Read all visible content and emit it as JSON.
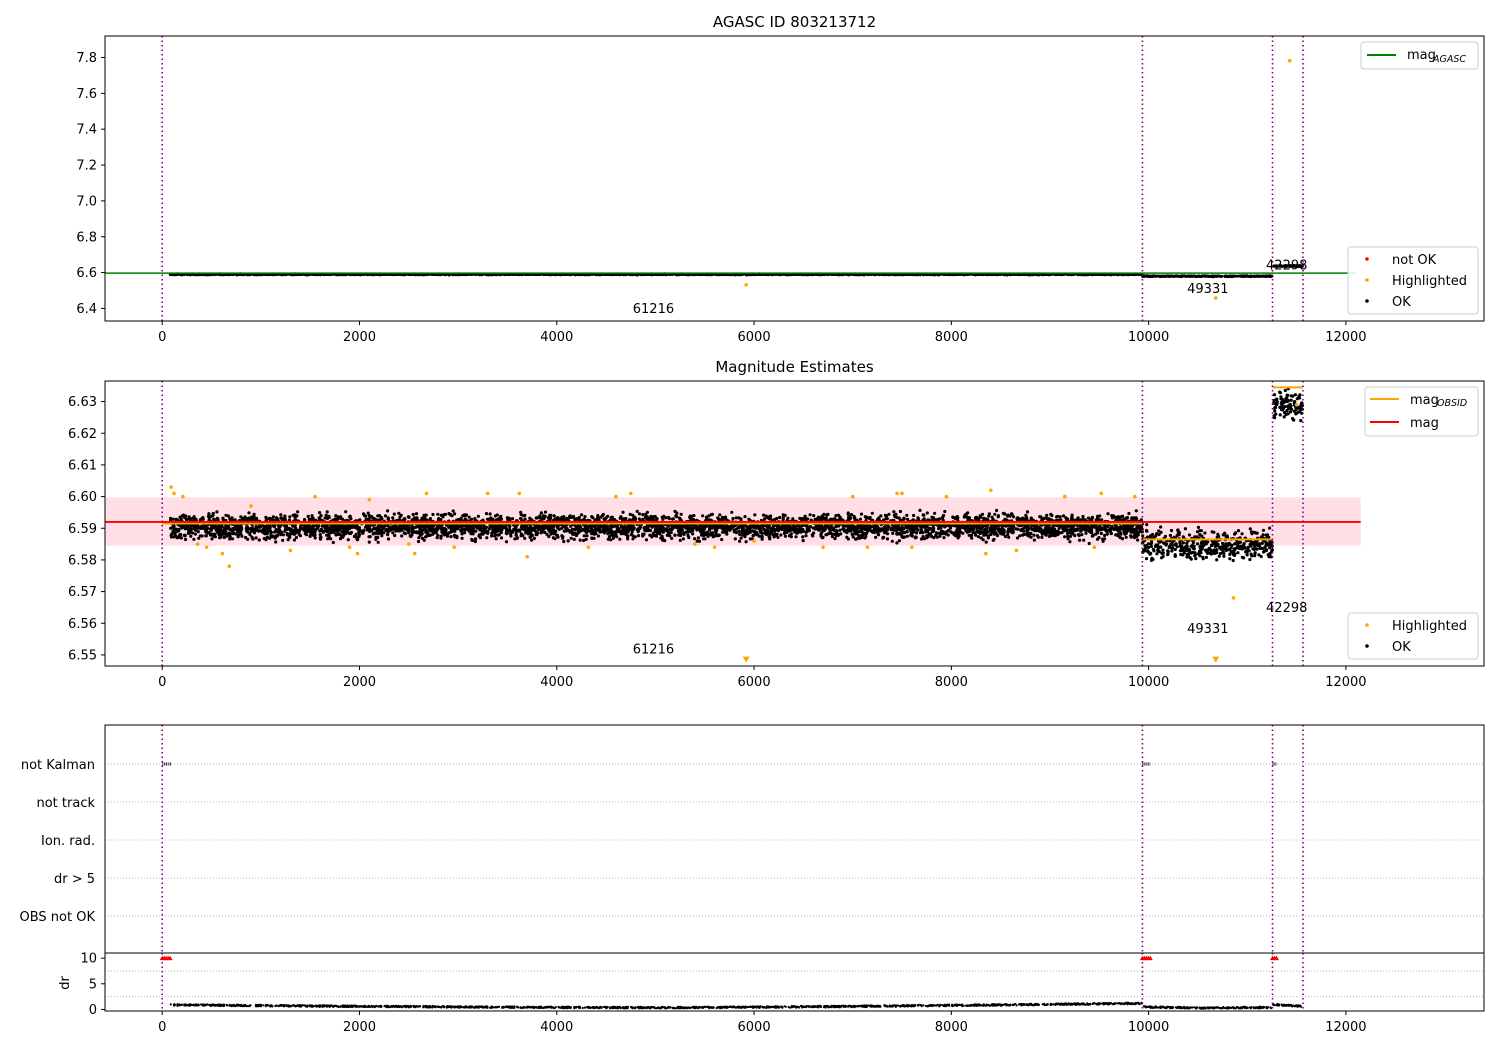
{
  "chart_data": [
    {
      "type": "scatter",
      "title": "AGASC ID 803213712",
      "xlim": [
        -580,
        13400
      ],
      "ylim": [
        6.33,
        7.92
      ],
      "x_ticks": [
        0,
        2000,
        4000,
        6000,
        8000,
        10000,
        12000
      ],
      "y_ticks": [
        6.4,
        6.6,
        6.8,
        7.0,
        7.2,
        7.4,
        7.6,
        7.8
      ],
      "vlines": [
        0,
        9937,
        11256,
        11565
      ],
      "hline": {
        "name": "mag_AGASC",
        "y": 6.597
      },
      "segments": [
        {
          "x": [
            80,
            9937
          ],
          "center": 6.59,
          "spread": 0.005
        },
        {
          "x": [
            9937,
            11256
          ],
          "center": 6.58,
          "spread": 0.005
        },
        {
          "x": [
            11256,
            11565
          ],
          "center": 6.637,
          "spread": 0.006
        }
      ],
      "highlighted": [
        [
          5920,
          6.532
        ],
        [
          10680,
          6.458
        ],
        [
          11430,
          7.782
        ]
      ],
      "annotations": [
        {
          "text": "61216",
          "x": 4980,
          "y": 6.375
        },
        {
          "text": "49331",
          "x": 10600,
          "y": 6.487
        },
        {
          "text": "42298",
          "x": 11400,
          "y": 6.618
        }
      ],
      "legend_line": {
        "base": "mag",
        "sub": "AGASC",
        "color": "#008000"
      },
      "legend_points": [
        {
          "label": "not OK",
          "color": "#ff0000"
        },
        {
          "label": "Highlighted",
          "color": "#ffa500"
        },
        {
          "label": "OK",
          "color": "#000000"
        }
      ]
    },
    {
      "type": "scatter",
      "title": "Magnitude Estimates",
      "xlim": [
        -580,
        13400
      ],
      "ylim": [
        6.5465,
        6.6365
      ],
      "x_ticks": [
        0,
        2000,
        4000,
        6000,
        8000,
        10000,
        12000
      ],
      "y_ticks": [
        6.55,
        6.56,
        6.57,
        6.58,
        6.59,
        6.6,
        6.61,
        6.62,
        6.63
      ],
      "vlines": [
        0,
        9937,
        11256,
        11565
      ],
      "band": {
        "x": [
          -580,
          12150
        ],
        "y": [
          6.5845,
          6.5998
        ],
        "color": "#ffc0cb"
      },
      "mag_line": {
        "name": "mag",
        "y": 6.592,
        "x": [
          -580,
          12150
        ],
        "color": "#ff0000"
      },
      "obsid_segments": [
        {
          "x": [
            0,
            9937
          ],
          "y": 6.5915
        },
        {
          "x": [
            9937,
            11256
          ],
          "y": 6.5865
        },
        {
          "x": [
            11256,
            11565
          ],
          "y": 6.6345
        }
      ],
      "segments": [
        {
          "x": [
            80,
            9937
          ],
          "center": 6.5905,
          "spread": 0.0055
        },
        {
          "x": [
            9937,
            11256
          ],
          "center": 6.5845,
          "spread": 0.007
        },
        {
          "x": [
            11256,
            11565
          ],
          "center": 6.629,
          "spread": 0.006
        }
      ],
      "highlighted": [
        [
          90,
          6.603
        ],
        [
          120,
          6.601
        ],
        [
          210,
          6.6
        ],
        [
          360,
          6.585
        ],
        [
          450,
          6.584
        ],
        [
          610,
          6.582
        ],
        [
          680,
          6.578
        ],
        [
          900,
          6.597
        ],
        [
          1300,
          6.583
        ],
        [
          1550,
          6.6
        ],
        [
          1900,
          6.584
        ],
        [
          1980,
          6.582
        ],
        [
          2100,
          6.599
        ],
        [
          2500,
          6.585
        ],
        [
          2560,
          6.582
        ],
        [
          2680,
          6.601
        ],
        [
          2960,
          6.584
        ],
        [
          3300,
          6.601
        ],
        [
          3620,
          6.601
        ],
        [
          3700,
          6.581
        ],
        [
          4320,
          6.584
        ],
        [
          4600,
          6.6
        ],
        [
          4750,
          6.601
        ],
        [
          5400,
          6.585
        ],
        [
          5600,
          6.584
        ],
        [
          6000,
          6.586
        ],
        [
          6700,
          6.584
        ],
        [
          7000,
          6.6
        ],
        [
          7150,
          6.584
        ],
        [
          7450,
          6.601
        ],
        [
          7500,
          6.601
        ],
        [
          7600,
          6.584
        ],
        [
          7950,
          6.6
        ],
        [
          8350,
          6.582
        ],
        [
          8400,
          6.602
        ],
        [
          8660,
          6.583
        ],
        [
          9150,
          6.6
        ],
        [
          9450,
          6.584
        ],
        [
          9520,
          6.601
        ],
        [
          9860,
          6.6
        ],
        [
          10860,
          6.568
        ],
        [
          11500,
          6.629
        ]
      ],
      "offscale": [
        [
          5920,
          6.5485
        ],
        [
          10680,
          6.5485
        ]
      ],
      "annotations": [
        {
          "text": "61216",
          "x": 4980,
          "y": 6.5505
        },
        {
          "text": "49331",
          "x": 10600,
          "y": 6.557
        },
        {
          "text": "42298",
          "x": 11400,
          "y": 6.5635
        }
      ],
      "legend_lines": [
        {
          "base": "mag",
          "sub": "OBSID",
          "color": "#ffa500"
        },
        {
          "base": "mag",
          "sub": "",
          "color": "#ff0000"
        }
      ],
      "legend_points": [
        {
          "label": "Highlighted",
          "color": "#ffa500"
        },
        {
          "label": "OK",
          "color": "#000000"
        }
      ]
    },
    {
      "type": "scatter",
      "xlim": [
        -580,
        13400
      ],
      "x_ticks": [
        0,
        2000,
        4000,
        6000,
        8000,
        10000,
        12000
      ],
      "vlines": [
        0,
        9937,
        11256,
        11565
      ],
      "flag_labels": [
        "not Kalman",
        "not track",
        "Ion. rad.",
        "dr > 5",
        "OBS not OK"
      ],
      "not_kalman_x": [
        [
          0,
          90
        ],
        [
          9937,
          10020
        ],
        [
          11256,
          11300
        ]
      ]
    },
    {
      "type": "scatter",
      "ylabel": "dr",
      "xlim": [
        -580,
        13400
      ],
      "ylim": [
        -0.3,
        11
      ],
      "x_ticks": [
        0,
        2000,
        4000,
        6000,
        8000,
        10000,
        12000
      ],
      "y_ticks": [
        0,
        5,
        10
      ],
      "vlines": [
        0,
        9937,
        11256,
        11565
      ],
      "clip_markers": [
        [
          0,
          90
        ],
        [
          9937,
          10020
        ],
        [
          11256,
          11300
        ]
      ],
      "clip_value": 10,
      "series": [
        {
          "x": [
            80,
            1000,
            2000,
            3000,
            4000,
            5000,
            6000,
            7000,
            8000,
            9000,
            9937
          ],
          "values": [
            0.9,
            0.75,
            0.6,
            0.5,
            0.4,
            0.35,
            0.45,
            0.6,
            0.8,
            1.0,
            1.2
          ]
        },
        {
          "x": [
            9937,
            10500,
            11256
          ],
          "values": [
            0.5,
            0.3,
            0.4
          ]
        },
        {
          "x": [
            11256,
            11400,
            11565
          ],
          "values": [
            1.0,
            0.8,
            0.6
          ]
        }
      ]
    }
  ]
}
